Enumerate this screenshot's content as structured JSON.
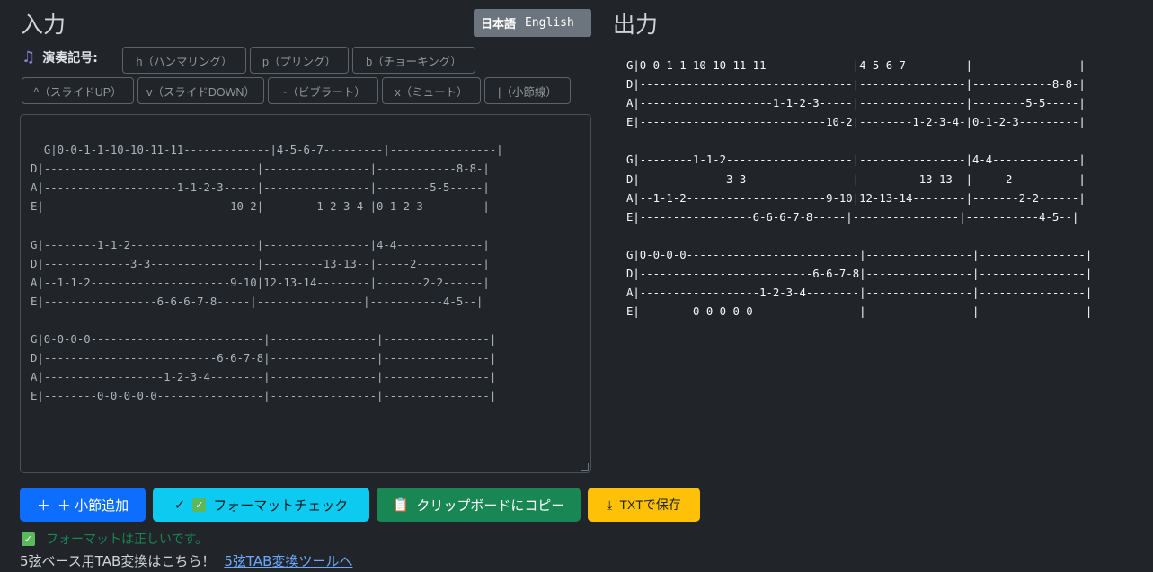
{
  "headings": {
    "input": "入力",
    "output": "出力"
  },
  "lang": {
    "ja": "日本語",
    "en": "English"
  },
  "notation": {
    "label": "演奏記号:",
    "buttons": [
      "h（ハンマリング）",
      "p（プリング）",
      "b（チョーキング）",
      "^（スライドUP）",
      "v（スライドDOWN）",
      "~（ビブラート）",
      "x（ミュート）",
      "|（小節線）"
    ]
  },
  "input_text": "G|0-0-1-1-10-10-11-11-------------|4-5-6-7---------|----------------|\nD|--------------------------------|----------------|------------8-8-|\nA|--------------------1-1-2-3-----|----------------|--------5-5-----|\nE|----------------------------10-2|--------1-2-3-4-|0-1-2-3---------|\n\nG|--------1-1-2-------------------|----------------|4-4-------------|\nD|-------------3-3----------------|---------13-13--|-----2----------|\nA|--1-1-2---------------------9-10|12-13-14--------|-------2-2------|\nE|-----------------6-6-6-7-8-----|----------------|-----------4-5--|\n\nG|0-0-0-0--------------------------|----------------|----------------|\nD|--------------------------6-6-7-8|----------------|----------------|\nA|------------------1-2-3-4--------|----------------|----------------|\nE|--------0-0-0-0-0----------------|----------------|----------------|",
  "output_text": "G|0-0-1-1-10-10-11-11-------------|4-5-6-7---------|----------------|\nD|--------------------------------|----------------|------------8-8-|\nA|--------------------1-1-2-3-----|----------------|--------5-5-----|\nE|----------------------------10-2|--------1-2-3-4-|0-1-2-3---------|\n\nG|--------1-1-2-------------------|----------------|4-4-------------|\nD|-------------3-3----------------|---------13-13--|-----2----------|\nA|--1-1-2---------------------9-10|12-13-14--------|-------2-2------|\nE|-----------------6-6-6-7-8-----|----------------|-----------4-5--|\n\nG|0-0-0-0--------------------------|----------------|----------------|\nD|--------------------------6-6-7-8|----------------|----------------|\nA|------------------1-2-3-4--------|----------------|----------------|\nE|--------0-0-0-0-0----------------|----------------|----------------|",
  "actions": {
    "add_measure": "＋ 小節追加",
    "format_check": "フォーマットチェック",
    "copy": "クリップボードにコピー",
    "save": "TXTで保存"
  },
  "status": "フォーマットは正しいです。",
  "footer": {
    "text": "5弦ベース用TAB変換はこちら！",
    "link": "5弦TAB変換ツールへ"
  }
}
